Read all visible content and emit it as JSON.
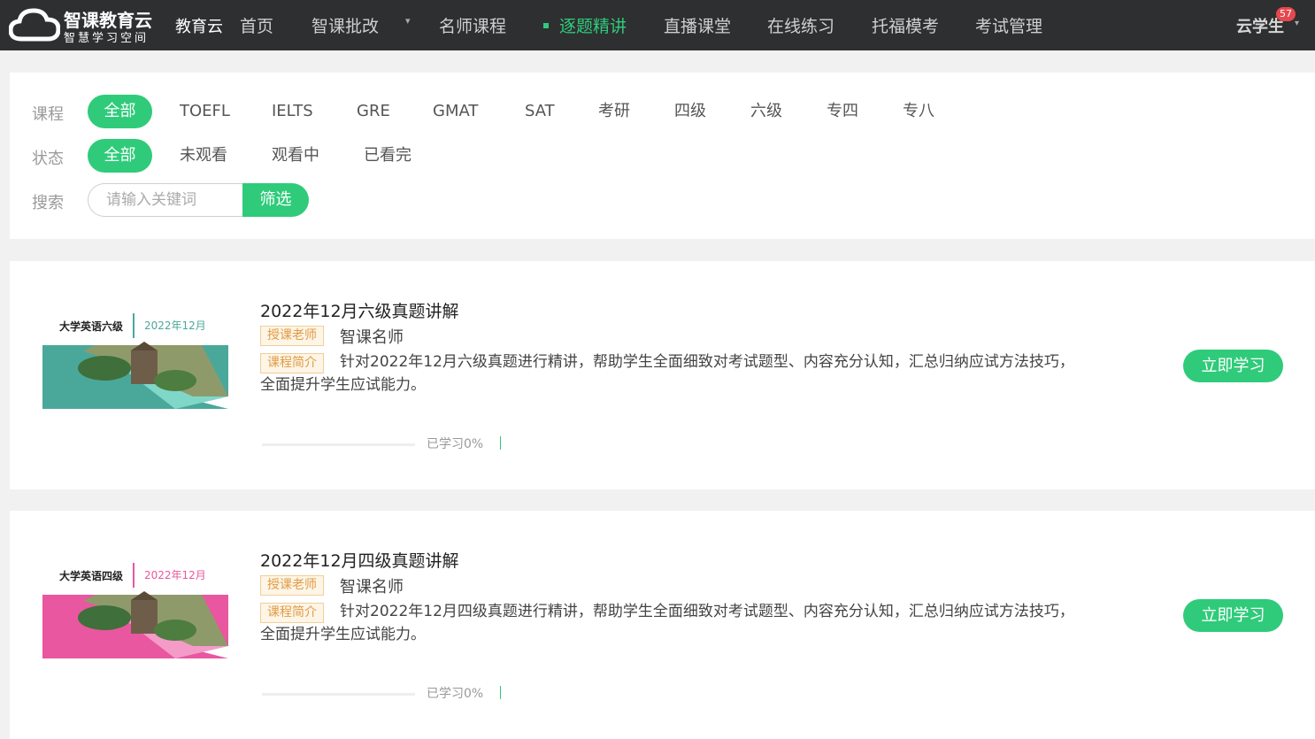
{
  "brand": {
    "title": "智课教育云",
    "subtitle": "智慧学习空间",
    "name": "教育云"
  },
  "nav": {
    "items": [
      {
        "label": "首页",
        "active": false
      },
      {
        "label": "智课批改",
        "active": false,
        "has_dropdown": true
      },
      {
        "label": "名师课程",
        "active": false
      },
      {
        "label": "逐题精讲",
        "active": true
      },
      {
        "label": "直播课堂",
        "active": false
      },
      {
        "label": "在线练习",
        "active": false
      },
      {
        "label": "托福模考",
        "active": false
      },
      {
        "label": "考试管理",
        "active": false
      }
    ],
    "caret_icon": "chevron-down-icon"
  },
  "user": {
    "name": "云学生",
    "badge": "57"
  },
  "filters": {
    "course_label": "课程",
    "courses": [
      "全部",
      "TOEFL",
      "IELTS",
      "GRE",
      "GMAT",
      "SAT",
      "考研",
      "四级",
      "六级",
      "专四",
      "专八"
    ],
    "course_selected": "全部",
    "status_label": "状态",
    "statuses": [
      "全部",
      "未观看",
      "观看中",
      "已看完"
    ],
    "status_selected": "全部",
    "search_label": "搜索",
    "search_placeholder": "请输入关键词",
    "search_value": "",
    "search_button": "筛选"
  },
  "courses": [
    {
      "thumb_title": "大学英语六级",
      "thumb_date": "2022年12月",
      "thumb_color": "#4aa89b",
      "title": "2022年12月六级真题讲解",
      "teacher_tag": "授课老师",
      "teacher": "智课名师",
      "intro_tag": "课程简介",
      "description": "针对2022年12月六级真题进行精讲，帮助学生全面细致对考试题型、内容充分认知，汇总归纳应试方法技巧，全面提升学生应试能力。",
      "progress_text": "已学习0%",
      "progress": 0,
      "button": "立即学习"
    },
    {
      "thumb_title": "大学英语四级",
      "thumb_date": "2022年12月",
      "thumb_color": "#e8579f",
      "title": "2022年12月四级真题讲解",
      "teacher_tag": "授课老师",
      "teacher": "智课名师",
      "intro_tag": "课程简介",
      "description": "针对2022年12月四级真题进行精讲，帮助学生全面细致对考试题型、内容充分认知，汇总归纳应试方法技巧，全面提升学生应试能力。",
      "progress_text": "已学习0%",
      "progress": 0,
      "button": "立即学习"
    }
  ],
  "colors": {
    "accent": "#2fcb7a",
    "nav_bg": "#2e2f31",
    "tag_text": "#e19b45"
  }
}
